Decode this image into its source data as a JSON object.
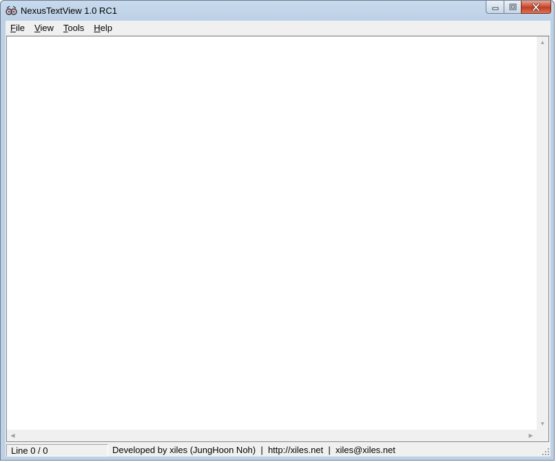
{
  "window": {
    "title": "NexusTextView 1.0 RC1"
  },
  "menubar": {
    "items": [
      {
        "accel": "F",
        "rest": "ile"
      },
      {
        "accel": "V",
        "rest": "iew"
      },
      {
        "accel": "T",
        "rest": "ools"
      },
      {
        "accel": "H",
        "rest": "elp"
      }
    ]
  },
  "editor": {
    "content": ""
  },
  "statusbar": {
    "line": "Line 0 / 0",
    "info": "Developed by xiles (JungHoon Noh)  |  http://xiles.net  |  xiles@xiles.net"
  },
  "colors": {
    "title_gradient_top": "#c8daec",
    "title_gradient_bottom": "#bcd0e6",
    "close_button": "#c74a2f",
    "client_bg": "#f0f0f0",
    "editor_bg": "#ffffff"
  },
  "icons": [
    "app-icon",
    "minimize-icon",
    "maximize-icon",
    "close-icon",
    "scroll-up-arrow-icon",
    "scroll-down-arrow-icon",
    "scroll-left-arrow-icon",
    "scroll-right-arrow-icon",
    "size-grip-icon"
  ]
}
